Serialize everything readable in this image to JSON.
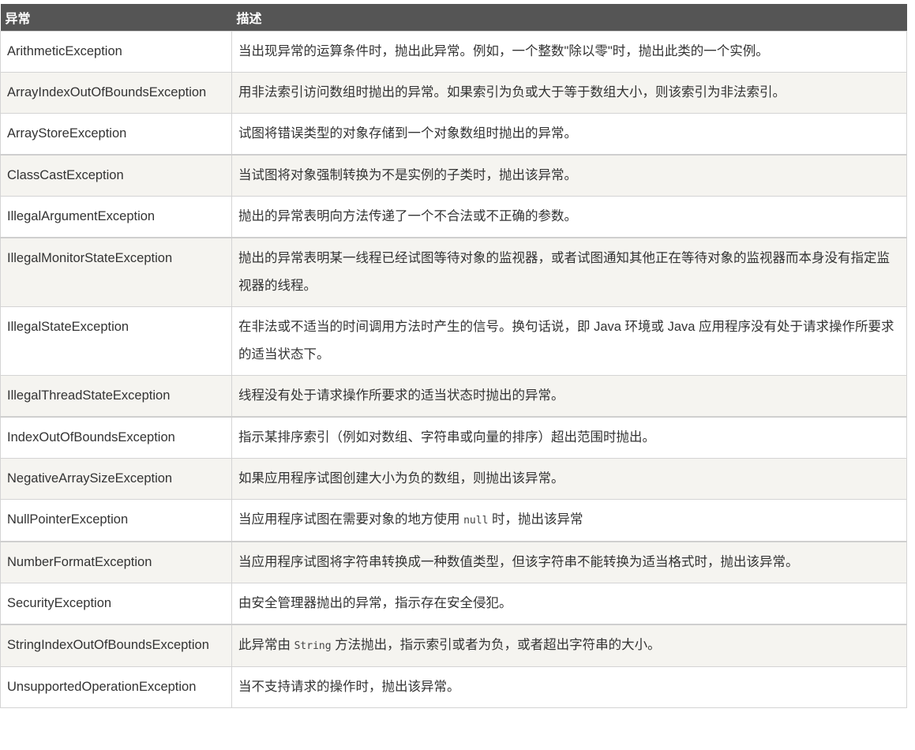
{
  "header": {
    "col1": "异常",
    "col2": "描述"
  },
  "rows": [
    {
      "name": "ArithmeticException",
      "desc": "当出现异常的运算条件时，抛出此异常。例如，一个整数\"除以零\"时，抛出此类的一个实例。"
    },
    {
      "name": "ArrayIndexOutOfBoundsException",
      "desc": "用非法索引访问数组时抛出的异常。如果索引为负或大于等于数组大小，则该索引为非法索引。"
    },
    {
      "name": "ArrayStoreException",
      "desc": "试图将错误类型的对象存储到一个对象数组时抛出的异常。"
    },
    {
      "name": "ClassCastException",
      "desc": "当试图将对象强制转换为不是实例的子类时，抛出该异常。"
    },
    {
      "name": "IllegalArgumentException",
      "desc": "抛出的异常表明向方法传递了一个不合法或不正确的参数。"
    },
    {
      "name": "IllegalMonitorStateException",
      "desc": "抛出的异常表明某一线程已经试图等待对象的监视器，或者试图通知其他正在等待对象的监视器而本身没有指定监视器的线程。"
    },
    {
      "name": "IllegalStateException",
      "desc": "在非法或不适当的时间调用方法时产生的信号。换句话说，即 Java 环境或 Java 应用程序没有处于请求操作所要求的适当状态下。"
    },
    {
      "name": "IllegalThreadStateException",
      "desc": "线程没有处于请求操作所要求的适当状态时抛出的异常。"
    },
    {
      "name": "IndexOutOfBoundsException",
      "desc": "指示某排序索引（例如对数组、字符串或向量的排序）超出范围时抛出。"
    },
    {
      "name": "NegativeArraySizeException",
      "desc": "如果应用程序试图创建大小为负的数组，则抛出该异常。"
    },
    {
      "name": "NullPointerException",
      "desc_pre": "当应用程序试图在需要对象的地方使用 ",
      "desc_code": "null",
      "desc_post": " 时，抛出该异常"
    },
    {
      "name": "NumberFormatException",
      "desc": "当应用程序试图将字符串转换成一种数值类型，但该字符串不能转换为适当格式时，抛出该异常。"
    },
    {
      "name": "SecurityException",
      "desc": "由安全管理器抛出的异常，指示存在安全侵犯。"
    },
    {
      "name": "StringIndexOutOfBoundsException",
      "desc_pre": "此异常由 ",
      "desc_code": "String",
      "desc_post": " 方法抛出，指示索引或者为负，或者超出字符串的大小。"
    },
    {
      "name": "UnsupportedOperationException",
      "desc": "当不支持请求的操作时，抛出该异常。"
    }
  ]
}
